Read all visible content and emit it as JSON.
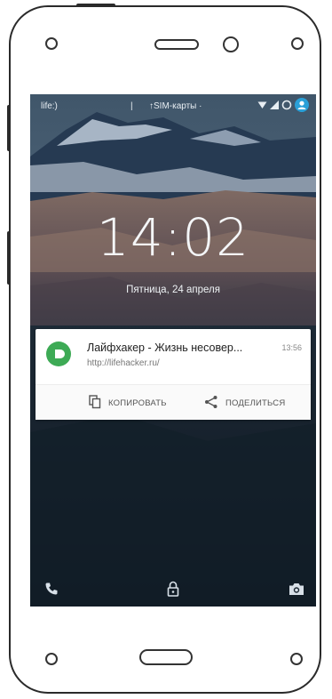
{
  "status_bar": {
    "carrier": "life:)",
    "separator": "|",
    "sim_label": "↑SIM-карты ·",
    "icons": [
      "wifi-icon",
      "signal-icon",
      "battery-icon",
      "user-avatar-icon"
    ]
  },
  "lockscreen": {
    "time": "14:02",
    "date": "Пятница, 24 апреля"
  },
  "notification": {
    "app_icon": "app-icon",
    "title": "Лайфхакер - Жизнь несовер...",
    "time": "13:56",
    "url": "http://lifehacker.ru/",
    "actions": [
      {
        "label": "КОПИРОВАТЬ",
        "icon": "copy-icon"
      },
      {
        "label": "ПОДЕЛИТЬСЯ",
        "icon": "share-icon"
      }
    ]
  },
  "bottom_shortcuts": [
    "phone-icon",
    "lock-icon",
    "camera-icon"
  ],
  "colors": {
    "app_accent": "#3daa55",
    "avatar": "#2aa0d8",
    "frame": "#2a2a2a"
  }
}
